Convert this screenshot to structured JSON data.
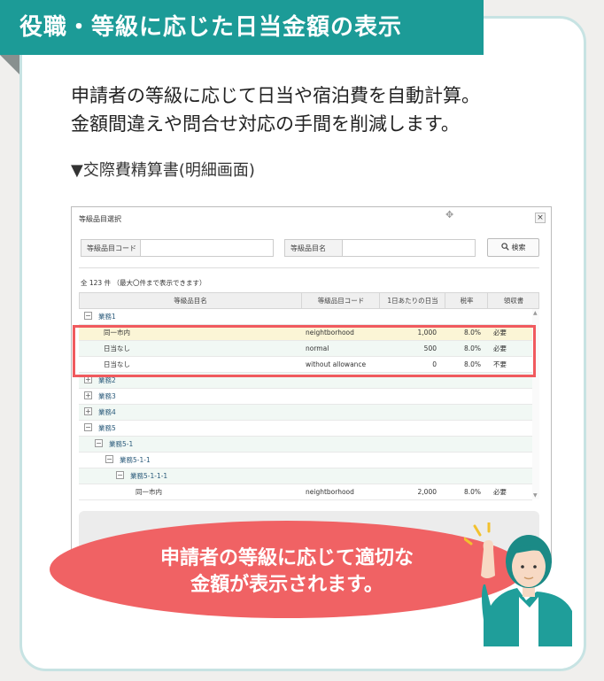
{
  "banner": {
    "title": "役職・等級に応じた日当金額の表示"
  },
  "description": {
    "line1": "申請者の等級に応じて日当や宿泊費を自動計算。",
    "line2": "金額間違えや問合せ対応の手間を削減します。"
  },
  "caption": "▼交際費精算書(明細画面)",
  "dialog": {
    "title": "等級品目選択",
    "close_glyph": "×",
    "drag_glyph": "✥",
    "field_code_label": "等級品目コード",
    "field_name_label": "等級品目名",
    "field_code_value": "",
    "field_name_value": "",
    "search_label": "検索",
    "search_icon": "magnifier-icon",
    "count_text": "全 123 件 （最大〇件まで表示できます）",
    "columns": [
      "等級品目名",
      "等級品目コード",
      "1日あたりの日当",
      "税率",
      "領収書"
    ],
    "groups": {
      "g1": "業務1",
      "g2": "業務2",
      "g3": "業務3",
      "g4": "業務4",
      "g5": "業務5",
      "g51": "業務5-1",
      "g511": "業務5-1-1",
      "g5111": "業務5-1-1-1"
    },
    "rows": [
      {
        "name": "同一市内",
        "code": "neightborhood",
        "amount": "1,000",
        "tax": "8.0%",
        "receipt": "必要"
      },
      {
        "name": "日当なし",
        "code": "normal",
        "amount": "500",
        "tax": "8.0%",
        "receipt": "必要"
      },
      {
        "name": "日当なし",
        "code": "without allowance",
        "amount": "0",
        "tax": "8.0%",
        "receipt": "不要"
      },
      {
        "name": "同一市内",
        "code": "neightborhood",
        "amount": "2,000",
        "tax": "8.0%",
        "receipt": "必要"
      }
    ],
    "toggle_minus": "−",
    "toggle_plus": "+"
  },
  "callout": {
    "line1": "申請者の等級に応じて適切な",
    "line2": "金額が表示されます。"
  },
  "colors": {
    "teal": "#1c9b97",
    "highlight_red": "#f05a5e",
    "bubble_red": "#f06264",
    "row_highlight": "#fbf5d6"
  }
}
